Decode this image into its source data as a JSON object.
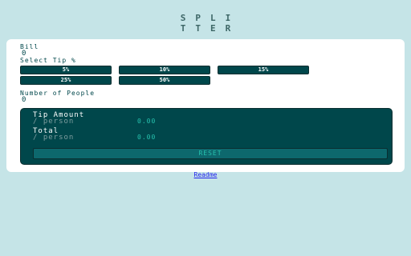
{
  "logo": {
    "line1": "SPLI",
    "line2": "TTER"
  },
  "bill": {
    "label": "Bill",
    "value": "0"
  },
  "tip": {
    "label": "Select Tip %",
    "options": [
      "5%",
      "10%",
      "15%",
      "25%",
      "50%"
    ]
  },
  "people": {
    "label": "Number of People",
    "value": "0"
  },
  "result": {
    "tip_label": "Tip Amount",
    "tip_sub": "/ person",
    "tip_value": "0.00",
    "total_label": "Total",
    "total_sub": "/ person",
    "total_value": "0.00",
    "reset_label": "RESET"
  },
  "footer": {
    "link": "Readme"
  },
  "colors": {
    "background": "#c5e4e7",
    "primary": "#00474b",
    "accent": "#26c2ae",
    "card": "#ffffff"
  }
}
